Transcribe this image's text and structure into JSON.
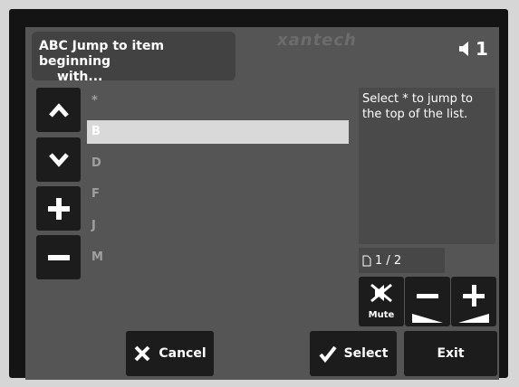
{
  "header": {
    "title_line1": "ABC Jump to item beginning",
    "title_line2": "with..."
  },
  "brand": {
    "logo": "xantech"
  },
  "volume": {
    "icon": "speaker-icon",
    "zone": "1"
  },
  "list": {
    "items": [
      {
        "label": "*",
        "selected": false
      },
      {
        "label": "B",
        "selected": true
      },
      {
        "label": "D",
        "selected": false
      },
      {
        "label": "F",
        "selected": false
      },
      {
        "label": "J",
        "selected": false
      },
      {
        "label": "M",
        "selected": false
      }
    ]
  },
  "side_buttons": {
    "up": "chevron-up-icon",
    "down": "chevron-down-icon",
    "plus": "plus-icon",
    "minus": "minus-icon"
  },
  "info": {
    "text": "Select * to jump to the top of the list."
  },
  "pager": {
    "icon": "page-icon",
    "text": "1 / 2"
  },
  "volume_controls": {
    "mute_label": "Mute"
  },
  "buttons": {
    "cancel": "Cancel",
    "select": "Select",
    "exit": "Exit"
  },
  "colors": {
    "screen": "#555555",
    "button": "#1c1c1c",
    "selected_row": "#d9d9d9",
    "text": "#ffffff",
    "muted_text": "#a0a0a0"
  }
}
